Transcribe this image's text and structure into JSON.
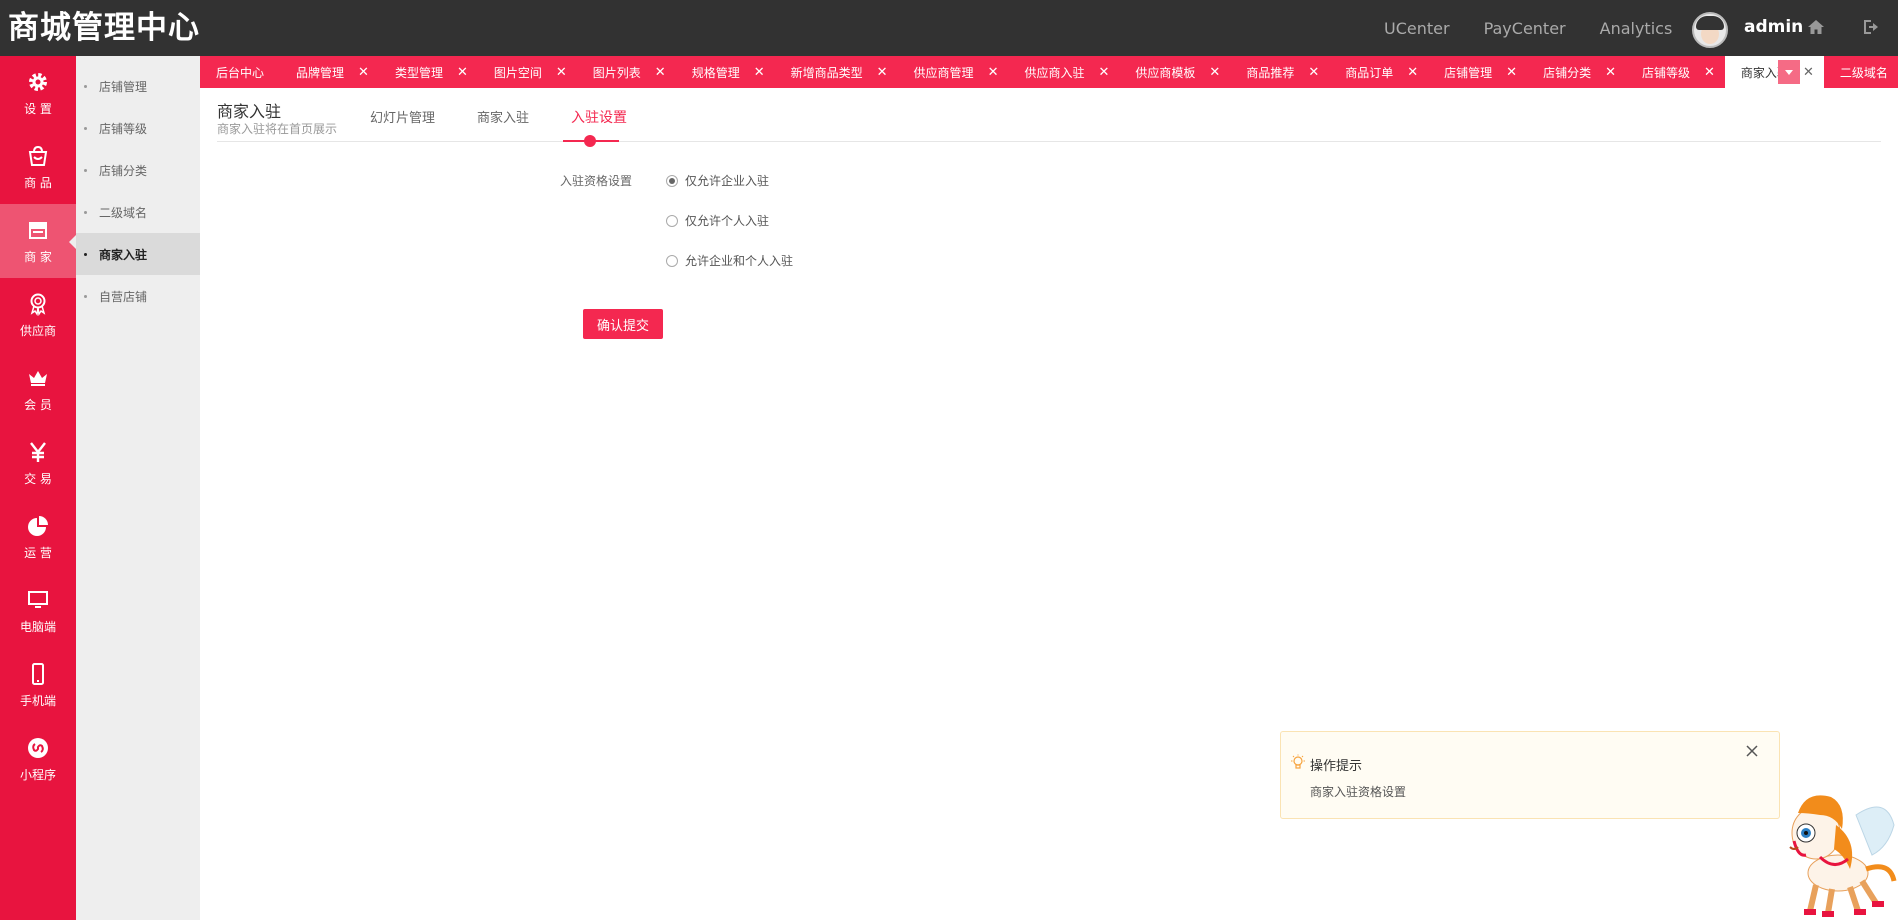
{
  "header": {
    "logo": "商城管理中心",
    "links": [
      "UCenter",
      "PayCenter",
      "Analytics"
    ],
    "user": "admin"
  },
  "sidebar": {
    "items": [
      {
        "label": "设 置",
        "icon": "gear-icon"
      },
      {
        "label": "商 品",
        "icon": "shopping-bag-icon"
      },
      {
        "label": "商 家",
        "icon": "store-icon",
        "active": true
      },
      {
        "label": "供应商",
        "icon": "badge-icon"
      },
      {
        "label": "会 员",
        "icon": "crown-icon"
      },
      {
        "label": "交 易",
        "icon": "yen-icon"
      },
      {
        "label": "运 营",
        "icon": "pie-chart-icon"
      },
      {
        "label": "电脑端",
        "icon": "monitor-icon"
      },
      {
        "label": "手机端",
        "icon": "mobile-icon"
      },
      {
        "label": "小程序",
        "icon": "mini-program-icon"
      }
    ]
  },
  "submenu": {
    "items": [
      "店铺管理",
      "店铺等级",
      "店铺分类",
      "二级域名",
      "商家入驻",
      "自营店铺"
    ],
    "active_index": 4
  },
  "tabs": {
    "items": [
      "后台中心",
      "品牌管理",
      "类型管理",
      "图片空间",
      "图片列表",
      "规格管理",
      "新增商品类型",
      "供应商管理",
      "供应商入驻",
      "供应商模板",
      "商品推荐",
      "商品订单",
      "店铺管理",
      "店铺分类",
      "店铺等级",
      "商家入驻",
      "二级域名"
    ],
    "active_index": 15,
    "close_glyph": "✕"
  },
  "page": {
    "title": "商家入驻",
    "subtitle": "商家入驻将在首页展示",
    "subtabs": [
      "幻灯片管理",
      "商家入驻",
      "入驻设置"
    ],
    "active_subtab": 2
  },
  "form": {
    "label": "入驻资格设置",
    "options": [
      "仅允许企业入驻",
      "仅允许个人入驻",
      "允许企业和个人入驻"
    ],
    "selected_index": 0,
    "submit_label": "确认提交"
  },
  "tip": {
    "title": "操作提示",
    "text": "商家入驻资格设置"
  },
  "colors": {
    "accent": "#f42850",
    "sidebar": "#e8143f",
    "header": "#323232"
  }
}
